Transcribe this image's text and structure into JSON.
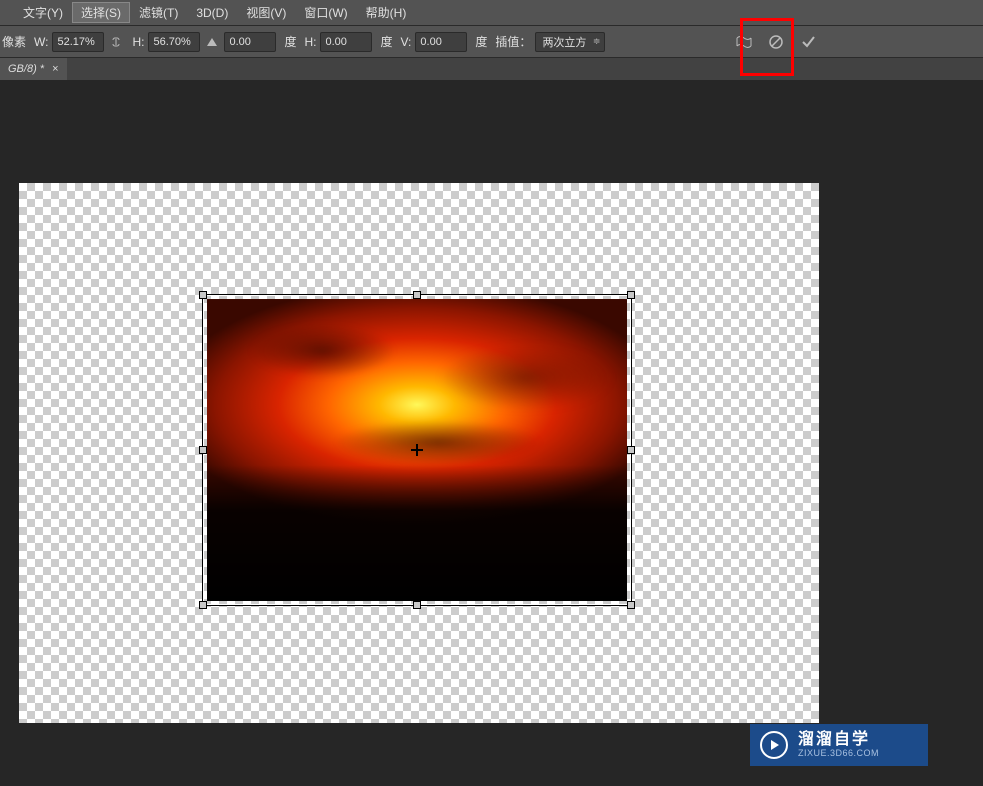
{
  "menu": {
    "type": "文字(Y)",
    "select": "选择(S)",
    "filter": "滤镜(T)",
    "threed": "3D(D)",
    "view": "视图(V)",
    "window": "窗口(W)",
    "help": "帮助(H)"
  },
  "options": {
    "pixel_label": "像素",
    "w_label": "W:",
    "w_value": "52.17%",
    "h_label": "H:",
    "h_value": "56.70%",
    "rotate_value": "0.00",
    "degree_label": "度",
    "h_skew_label": "H:",
    "h_skew_value": "0.00",
    "v_skew_label": "V:",
    "v_skew_value": "0.00",
    "interp_label": "插值：",
    "interp_value": "两次立方"
  },
  "tab": {
    "name": "GB/8) *",
    "close": "×"
  },
  "watermark": {
    "title": "溜溜自学",
    "url": "ZIXUE.3D66.COM"
  }
}
